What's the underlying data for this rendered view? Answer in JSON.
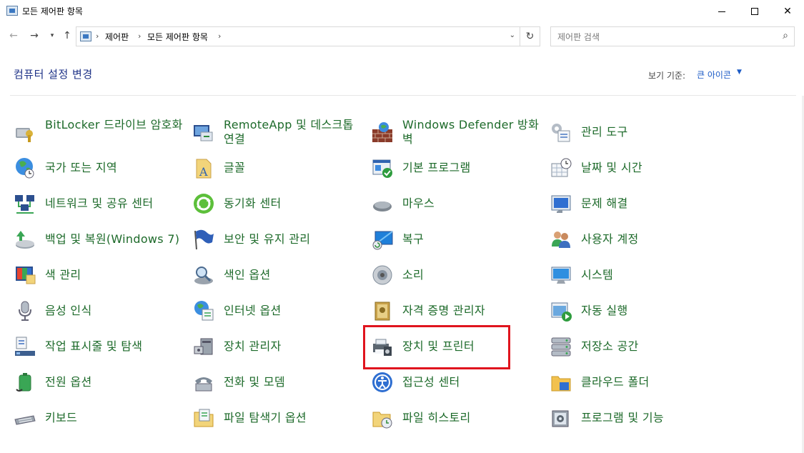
{
  "window": {
    "title": "모든 제어판 항목"
  },
  "address": {
    "crumbs": [
      "제어판",
      "모든 제어판 항목"
    ]
  },
  "search": {
    "placeholder": "제어판 검색"
  },
  "header": {
    "title": "컴퓨터 설정 변경",
    "view_by_label": "보기 기준:",
    "view_by_value": "큰 아이콘"
  },
  "colors": {
    "link_green": "#1d6a2a",
    "title_blue": "#1e3287",
    "highlight_red": "#e0141e"
  },
  "items": [
    {
      "label": "BitLocker 드라이브 암호화",
      "icon": "bitlocker-icon"
    },
    {
      "label": "RemoteApp 및 데스크톱 연결",
      "icon": "remoteapp-icon"
    },
    {
      "label": "Windows Defender 방화벽",
      "icon": "firewall-icon"
    },
    {
      "label": "관리 도구",
      "icon": "admin-tools-icon"
    },
    {
      "label": "국가 또는 지역",
      "icon": "region-icon"
    },
    {
      "label": "글꼴",
      "icon": "fonts-icon"
    },
    {
      "label": "기본 프로그램",
      "icon": "default-programs-icon"
    },
    {
      "label": "날짜 및 시간",
      "icon": "date-time-icon"
    },
    {
      "label": "네트워크 및 공유 센터",
      "icon": "network-icon"
    },
    {
      "label": "동기화 센터",
      "icon": "sync-icon"
    },
    {
      "label": "마우스",
      "icon": "mouse-icon"
    },
    {
      "label": "문제 해결",
      "icon": "troubleshoot-icon"
    },
    {
      "label": "백업 및 복원(Windows 7)",
      "icon": "backup-icon"
    },
    {
      "label": "보안 및 유지 관리",
      "icon": "security-flag-icon"
    },
    {
      "label": "복구",
      "icon": "recovery-icon"
    },
    {
      "label": "사용자 계정",
      "icon": "user-accounts-icon"
    },
    {
      "label": "색 관리",
      "icon": "color-management-icon"
    },
    {
      "label": "색인 옵션",
      "icon": "indexing-icon"
    },
    {
      "label": "소리",
      "icon": "sound-icon"
    },
    {
      "label": "시스템",
      "icon": "system-icon"
    },
    {
      "label": "음성 인식",
      "icon": "microphone-icon"
    },
    {
      "label": "인터넷 옵션",
      "icon": "internet-options-icon"
    },
    {
      "label": "자격 증명 관리자",
      "icon": "credential-icon"
    },
    {
      "label": "자동 실행",
      "icon": "autoplay-icon"
    },
    {
      "label": "작업 표시줄 및 탐색",
      "icon": "taskbar-icon"
    },
    {
      "label": "장치 관리자",
      "icon": "device-manager-icon"
    },
    {
      "label": "장치 및 프린터",
      "icon": "printer-icon"
    },
    {
      "label": "저장소 공간",
      "icon": "storage-spaces-icon"
    },
    {
      "label": "전원 옵션",
      "icon": "power-icon"
    },
    {
      "label": "전화 및 모뎀",
      "icon": "phone-modem-icon"
    },
    {
      "label": "접근성 센터",
      "icon": "accessibility-icon"
    },
    {
      "label": "클라우드 폴더",
      "icon": "work-folders-icon"
    },
    {
      "label": "키보드",
      "icon": "keyboard-icon"
    },
    {
      "label": "파일 탐색기 옵션",
      "icon": "folder-options-icon"
    },
    {
      "label": "파일 히스토리",
      "icon": "file-history-icon"
    },
    {
      "label": "프로그램 및 기능",
      "icon": "programs-features-icon"
    }
  ]
}
